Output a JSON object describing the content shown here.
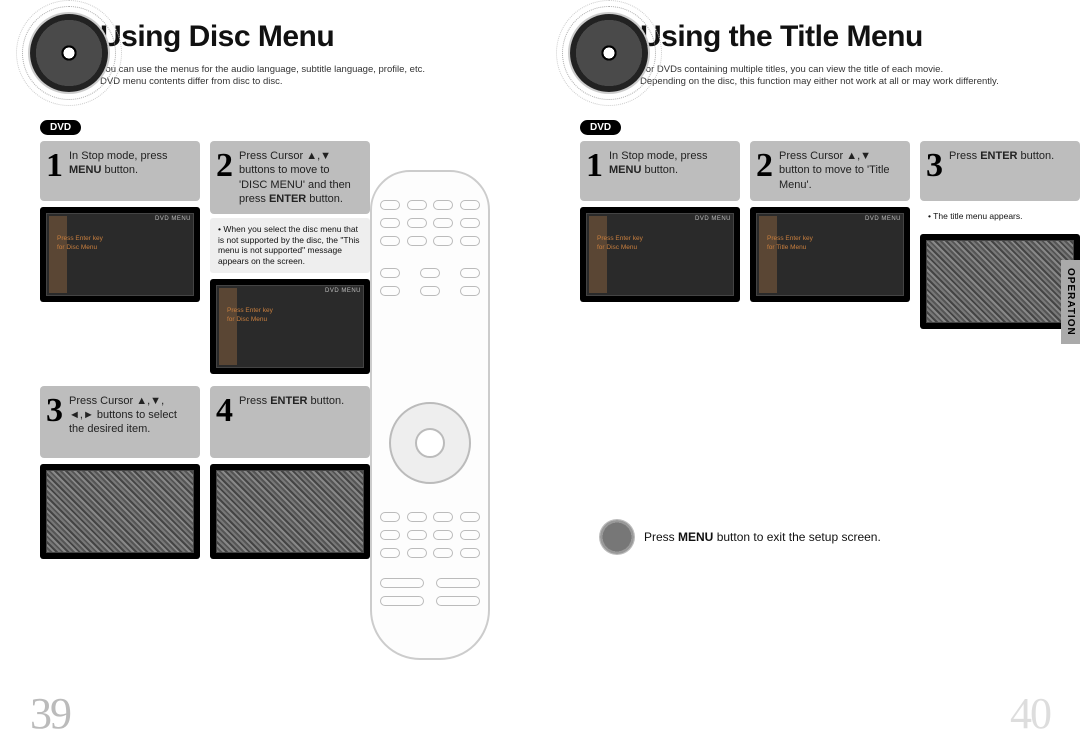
{
  "left": {
    "title": "Using Disc Menu",
    "sub1": "You can use the menus for the audio language, subtitle language, profile, etc.",
    "sub2": "DVD menu contents differ from disc to disc.",
    "badge": "DVD",
    "steps": {
      "s1": {
        "num": "1",
        "text": "In Stop mode, press <b>MENU</b> button."
      },
      "s2": {
        "num": "2",
        "text": "Press Cursor ▲,▼ buttons to move to 'DISC MENU' and then press <b>ENTER</b> button."
      },
      "s2note": "• When you select the disc menu that is not supported by the disc, the \"This menu is not supported\" message appears on the screen.",
      "s3": {
        "num": "3",
        "text": "Press Cursor ▲,▼, ◄,► buttons to select the desired item."
      },
      "s4": {
        "num": "4",
        "text": "Press <b>ENTER</b> button."
      }
    },
    "tv_label": "DVD MENU",
    "tv_msg1": "Press Enter key",
    "tv_msg2": "for Disc Menu",
    "page_num": "39"
  },
  "right": {
    "title": "Using the Title Menu",
    "sub1": "For DVDs containing multiple titles, you can view the title of each movie.",
    "sub2": "Depending on the disc, this function may either not work at all or may work differently.",
    "badge": "DVD",
    "steps": {
      "s1": {
        "num": "1",
        "text": "In Stop mode, press <b>MENU</b> button."
      },
      "s2": {
        "num": "2",
        "text": "Press Cursor ▲,▼ button to move to 'Title Menu'."
      },
      "s3": {
        "num": "3",
        "text": "Press <b>ENTER</b> button."
      },
      "s3note": "• The title menu appears."
    },
    "tv_label": "DVD MENU",
    "tv_msg1a": "Press Enter key",
    "tv_msg2a": "for Disc Menu",
    "tv_msg1b": "Press Enter key",
    "tv_msg2b": "for Title Menu",
    "side_tab": "OPERATION",
    "exit_note": "Press <b>MENU</b> button to exit the setup screen.",
    "page_num": "40"
  }
}
